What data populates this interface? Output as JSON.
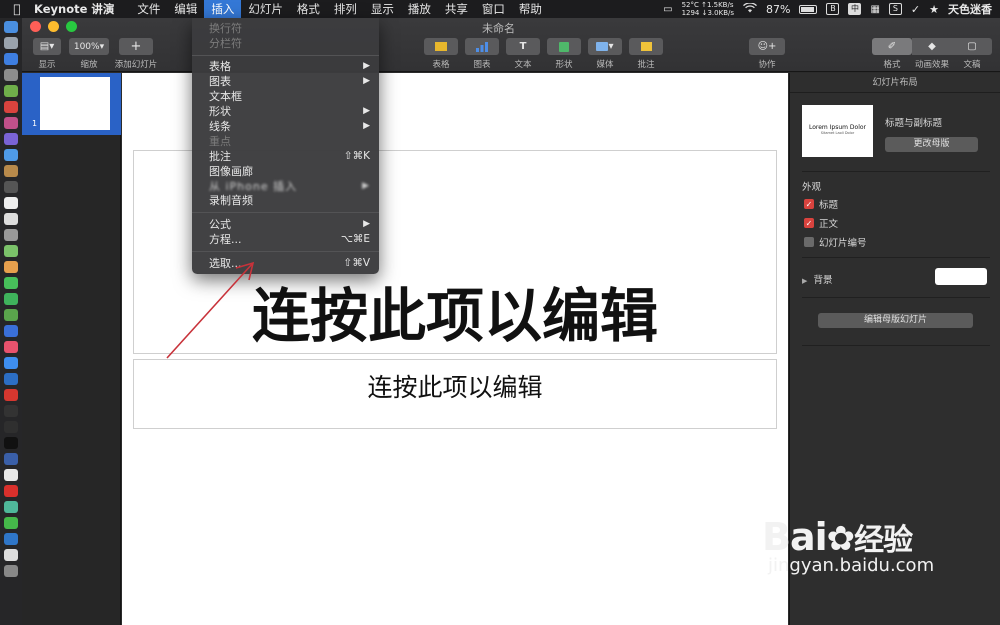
{
  "menubar": {
    "app_name": "Keynote 讲演",
    "items": [
      "文件",
      "编辑",
      "插入",
      "幻灯片",
      "格式",
      "排列",
      "显示",
      "播放",
      "共享",
      "窗口",
      "帮助"
    ],
    "active_item": "插入",
    "status": {
      "temp_up": "52°C ↑1.5KB/s",
      "cpu_down": "1294 ↓3.0KB/s",
      "battery": "87%",
      "input_method": "中",
      "user": "天色迷香"
    }
  },
  "window": {
    "title": "未命名",
    "toolbar": {
      "view_label": "显示",
      "zoom_value": "100%",
      "zoom_label": "缩放",
      "add_slide_label": "添加幻灯片",
      "table_label": "表格",
      "chart_label": "图表",
      "text_label": "文本",
      "shape_label": "形状",
      "media_label": "媒体",
      "comment_label": "批注",
      "collaborate_label": "协作",
      "format_label": "格式",
      "animate_label": "动画效果",
      "document_label": "文稿"
    }
  },
  "navigator": {
    "slide_number": "1"
  },
  "slide": {
    "title": "连按此项以编辑",
    "subtitle": "连按此项以编辑"
  },
  "inspector": {
    "header": "幻灯片布局",
    "layout_thumb_title": "Lorem Ipsum Dolor",
    "layout_thumb_sub": "Sitamet Laoli Dolor",
    "layout_name": "标题与副标题",
    "change_master": "更改母版",
    "appearance_label": "外观",
    "title_cb": "标题",
    "body_cb": "正文",
    "slide_number_cb": "幻灯片编号",
    "background_label": "背景",
    "edit_master": "编辑母版幻灯片",
    "accent_color": "#d9433e"
  },
  "insert_menu": {
    "items": {
      "line_break": "换行符",
      "column_break": "分栏符",
      "table": "表格",
      "chart": "图表",
      "text_box": "文本框",
      "shape": "形状",
      "line": "线条",
      "highlight": "重点",
      "comment": "批注",
      "comment_shortcut": "⇧⌘K",
      "image_gallery": "图像画廊",
      "blurred_item": "从 iPhone 插入",
      "record_audio": "录制音频",
      "formula": "公式",
      "equation": "方程...",
      "equation_shortcut": "⌥⌘E",
      "choose": "选取...",
      "choose_shortcut": "⇧⌘V"
    }
  },
  "watermark": {
    "brand": "Bai",
    "brand2": "经验",
    "url": "jingyan.baidu.com"
  }
}
